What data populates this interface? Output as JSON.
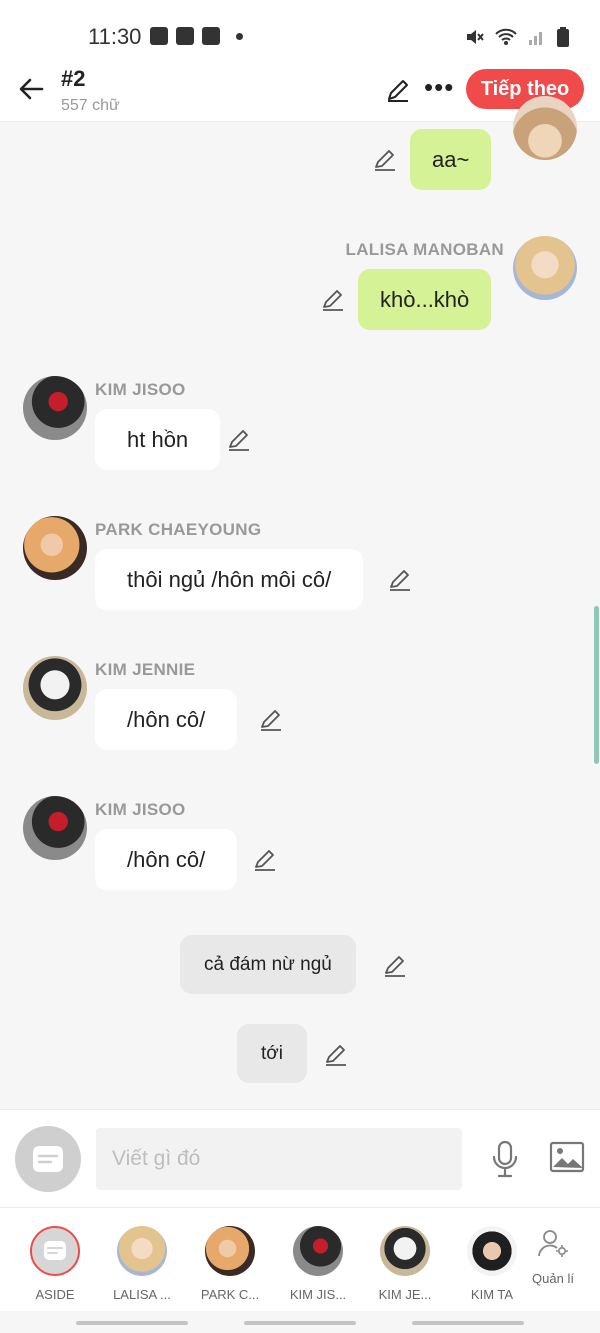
{
  "status_bar": {
    "time": "11:30"
  },
  "header": {
    "title": "#2",
    "subtitle": "557 chữ",
    "next_label": "Tiếp theo",
    "more_label": "•••"
  },
  "messages": [
    {
      "kind": "right",
      "sender": "",
      "text": "aa~"
    },
    {
      "kind": "right",
      "sender": "LALISA MANOBAN",
      "text": "khò...khò"
    },
    {
      "kind": "left",
      "sender": "KIM JISOO",
      "text": "ht hồn"
    },
    {
      "kind": "left",
      "sender": "PARK CHAEYOUNG",
      "text": "thôi ngủ /hôn môi cô/"
    },
    {
      "kind": "left",
      "sender": "KIM JENNIE",
      "text": "/hôn  cô/"
    },
    {
      "kind": "left",
      "sender": "KIM JISOO",
      "text": "/hôn cô/"
    },
    {
      "kind": "aside",
      "sender": "",
      "text": "cả đám nừ ngủ"
    },
    {
      "kind": "aside",
      "sender": "",
      "text": "tới"
    }
  ],
  "composer": {
    "placeholder": "Viết gì đó"
  },
  "characters": [
    {
      "label": "ASIDE"
    },
    {
      "label": "LALISA ..."
    },
    {
      "label": "PARK C..."
    },
    {
      "label": "KIM JIS..."
    },
    {
      "label": "KIM JE..."
    },
    {
      "label": "KIM TA"
    }
  ],
  "manage_label": "Quản lí",
  "colors": {
    "accent": "#f04a4a",
    "bubble_right": "#d6f296",
    "bubble_left": "#ffffff",
    "aside": "#e8e8e8"
  }
}
